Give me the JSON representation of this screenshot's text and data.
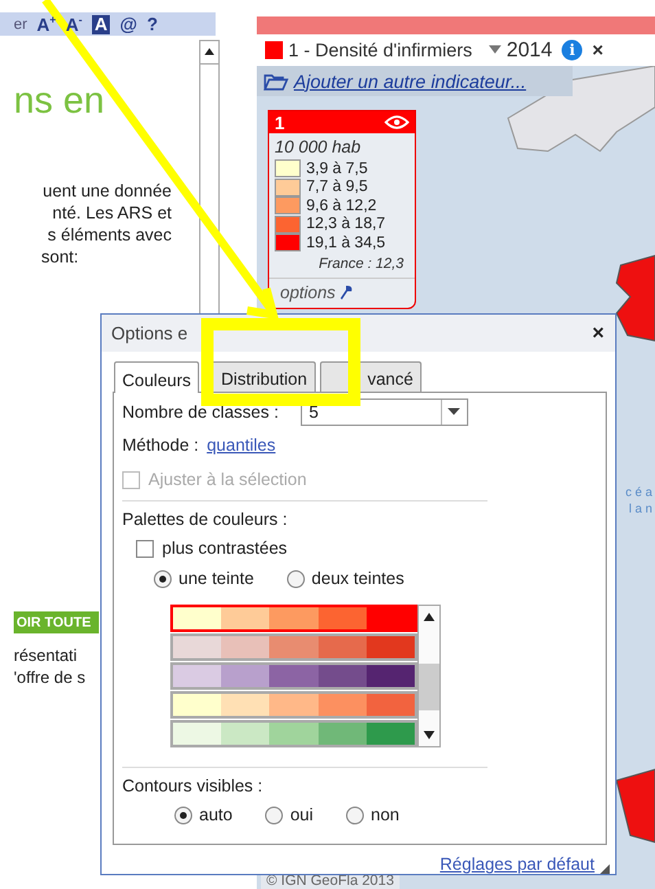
{
  "toolbar": {
    "text": "er",
    "icons": [
      {
        "kind": "font-up",
        "char": "A$^{+}$"
      },
      {
        "kind": "font-down",
        "char": "A$^{-}$"
      },
      {
        "kind": "font-box",
        "char": "A"
      },
      {
        "kind": "plain",
        "char": "@"
      },
      {
        "kind": "plain",
        "char": "?"
      }
    ]
  },
  "article": {
    "heading": "ns en",
    "lines": [
      "uent une donnée",
      "nté. Les ARS et",
      "s éléments avec",
      "sont:"
    ],
    "button": "OIR TOUTE",
    "lines_2": [
      "résentati",
      "'offre de s"
    ]
  },
  "map": {
    "indicator": {
      "color": "#ff0000",
      "name": "1 - Densité d'infirmiers",
      "year": "2014",
      "info": "i",
      "close": "×"
    },
    "add_link": "Ajouter un autre indicateur...",
    "legend": {
      "number": "1",
      "unit": "10 000 hab",
      "classes": [
        {
          "label": "3,9 à 7,5",
          "color": "#ffffcc"
        },
        {
          "label": "7,7 à 9,5",
          "color": "#fecb98"
        },
        {
          "label": "9,6 à 12,2",
          "color": "#fd9a60"
        },
        {
          "label": "12,3 à 18,7",
          "color": "#fc6431"
        },
        {
          "label": "19,1 à 34,5",
          "color": "#ff0000"
        }
      ],
      "france": "France : 12,3",
      "options": "options"
    },
    "map_labels": [
      "c é a",
      "l a n"
    ],
    "credit": "© IGN GeoFla 2013"
  },
  "dialog": {
    "title": "Options e",
    "close": "×",
    "tabs": [
      {
        "label": "Couleurs",
        "selected": true
      },
      {
        "label": "Distribution",
        "selected": false
      },
      {
        "label": "vancé",
        "selected": false
      }
    ],
    "classes_label": "Nombre de classes :",
    "classes_value": "5",
    "method_label": "Méthode :",
    "method_link": "quantiles",
    "adjust": {
      "label": "Ajuster à la sélection",
      "checked": false,
      "disabled": true
    },
    "palettes_label": "Palettes de couleurs :",
    "contrast": {
      "label": "plus contrastées",
      "checked": false
    },
    "tints": [
      {
        "label": "une teinte",
        "selected": true
      },
      {
        "label": "deux teintes",
        "selected": false
      }
    ],
    "palettes": [
      {
        "selected": true,
        "swatches": [
          {
            "color": "#ffffcc"
          },
          {
            "color": "#fecb98"
          },
          {
            "color": "#fd9a60"
          },
          {
            "color": "#fc6431"
          },
          {
            "color": "#ff0000"
          }
        ]
      },
      {
        "selected": false,
        "swatches": [
          {
            "color": "#e8d8d8"
          },
          {
            "color": "#e8c0b8"
          },
          {
            "color": "#e88c70"
          },
          {
            "color": "#e66a4c"
          },
          {
            "color": "#e2381e"
          }
        ]
      },
      {
        "selected": false,
        "swatches": [
          {
            "color": "#dacbe3"
          },
          {
            "color": "#b8a0cc"
          },
          {
            "color": "#8c64a4"
          },
          {
            "color": "#744c8c"
          },
          {
            "color": "#552470"
          }
        ]
      },
      {
        "selected": false,
        "swatches": [
          {
            "color": "#ffffcc"
          },
          {
            "color": "#ffe0b4"
          },
          {
            "color": "#ffb888"
          },
          {
            "color": "#fc9060"
          },
          {
            "color": "#f2633f"
          }
        ]
      },
      {
        "selected": false,
        "swatches": [
          {
            "color": "#edf8e4"
          },
          {
            "color": "#cbe8c4"
          },
          {
            "color": "#a0d49c"
          },
          {
            "color": "#70b878"
          },
          {
            "color": "#2e9a4c"
          }
        ]
      }
    ],
    "contours_label": "Contours visibles :",
    "contours": [
      {
        "label": "auto",
        "selected": true
      },
      {
        "label": "oui",
        "selected": false
      },
      {
        "label": "non",
        "selected": false
      }
    ],
    "reset": "Réglages par défaut"
  }
}
